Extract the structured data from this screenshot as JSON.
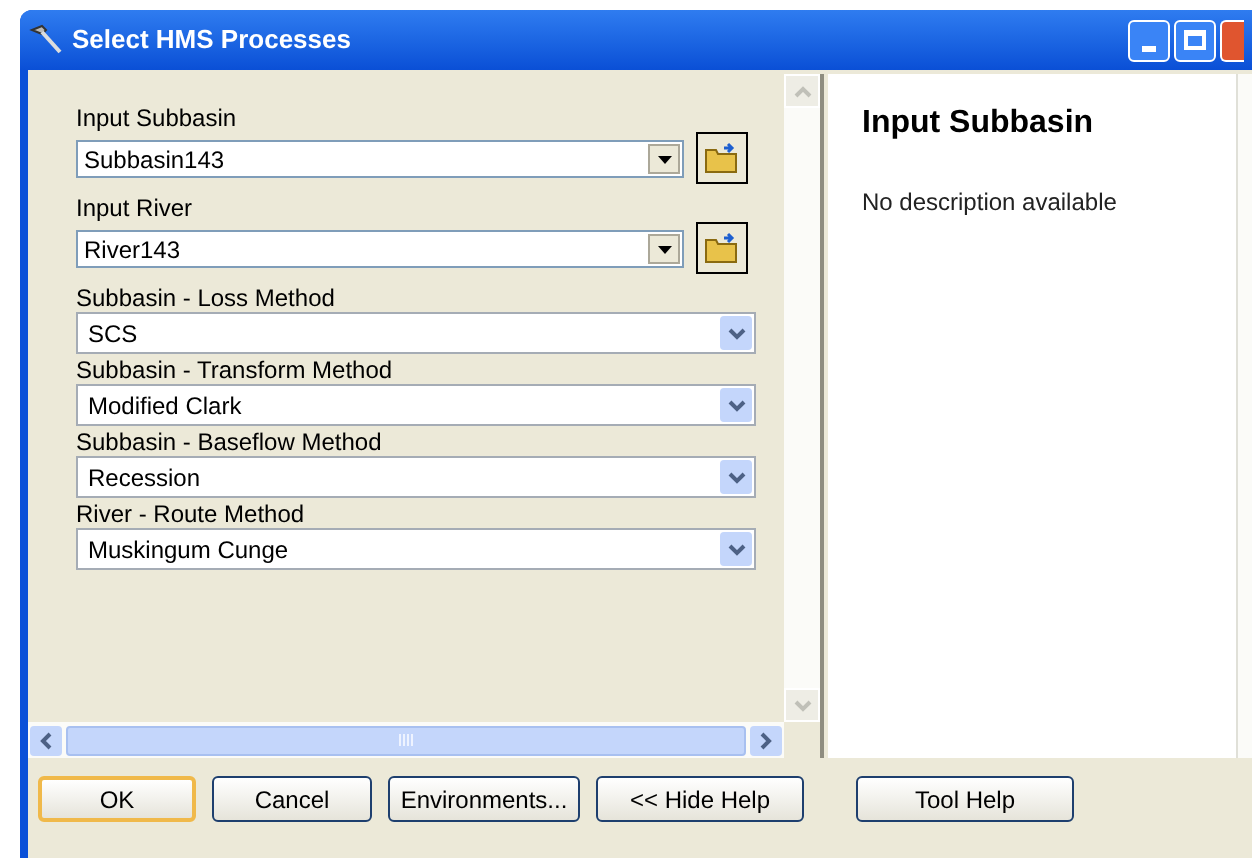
{
  "window": {
    "title": "Select HMS Processes"
  },
  "fields": [
    {
      "kind": "dataset",
      "label": "Input Subbasin",
      "value": "Subbasin143"
    },
    {
      "kind": "dataset",
      "label": "Input River",
      "value": "River143"
    },
    {
      "kind": "select",
      "label": "Subbasin - Loss Method",
      "value": "SCS"
    },
    {
      "kind": "select",
      "label": "Subbasin - Transform Method",
      "value": "Modified Clark"
    },
    {
      "kind": "select",
      "label": "Subbasin - Baseflow Method",
      "value": "Recession"
    },
    {
      "kind": "select",
      "label": "River - Route Method",
      "value": "Muskingum Cunge"
    }
  ],
  "help": {
    "title": "Input Subbasin",
    "description": "No description available"
  },
  "buttons": [
    {
      "label": "OK",
      "focused": true
    },
    {
      "label": "Cancel",
      "focused": false
    },
    {
      "label": "Environments...",
      "focused": false
    },
    {
      "label": "<< Hide Help",
      "focused": false
    },
    {
      "label": "Tool Help",
      "focused": false
    }
  ]
}
